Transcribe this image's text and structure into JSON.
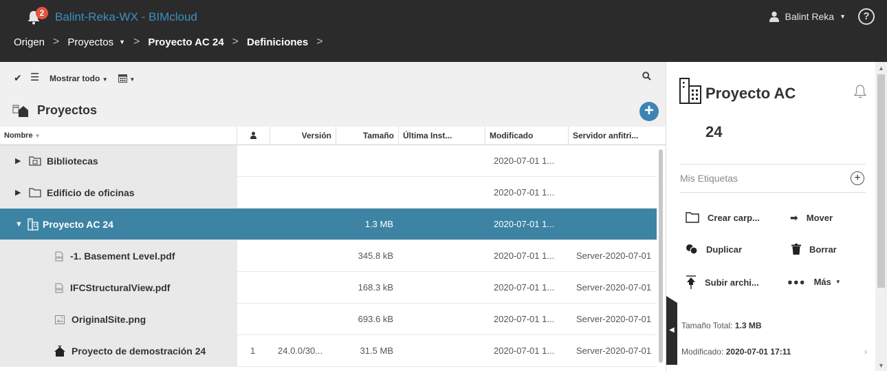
{
  "header": {
    "notification_count": "2",
    "title": "Balint-Reka-WX - BIMcloud",
    "user_name": "Balint Reka",
    "help": "?"
  },
  "breadcrumb": [
    {
      "label": "Origen"
    },
    {
      "label": "Proyectos"
    },
    {
      "label": "Proyecto AC 24"
    },
    {
      "label": "Definiciones"
    }
  ],
  "toolbar": {
    "filter_label": "Mostrar todo"
  },
  "section": {
    "title": "Proyectos"
  },
  "table": {
    "columns": [
      "Nombre",
      "",
      "Versión",
      "Tamaño",
      "Última Inst...",
      "Modificado",
      "Servidor anfitri..."
    ],
    "rows": [
      {
        "name": "Bibliotecas",
        "users": "",
        "version": "",
        "size": "",
        "last": "",
        "modified": "2020-07-01 1...",
        "server": ""
      },
      {
        "name": "Edificio de oficinas",
        "users": "",
        "version": "",
        "size": "",
        "last": "",
        "modified": "2020-07-01 1...",
        "server": ""
      },
      {
        "name": "Proyecto AC 24",
        "users": "",
        "version": "",
        "size": "1.3 MB",
        "last": "",
        "modified": "2020-07-01 1...",
        "server": ""
      },
      {
        "name": "-1. Basement Level.pdf",
        "users": "",
        "version": "",
        "size": "345.8 kB",
        "last": "",
        "modified": "2020-07-01 1...",
        "server": "Server-2020-07-01"
      },
      {
        "name": "IFCStructuralView.pdf",
        "users": "",
        "version": "",
        "size": "168.3 kB",
        "last": "",
        "modified": "2020-07-01 1...",
        "server": "Server-2020-07-01"
      },
      {
        "name": "OriginalSite.png",
        "users": "",
        "version": "",
        "size": "693.6 kB",
        "last": "",
        "modified": "2020-07-01 1...",
        "server": "Server-2020-07-01"
      },
      {
        "name": "Proyecto de demostración 24",
        "users": "1",
        "version": "24.0.0/30...",
        "size": "31.5 MB",
        "last": "",
        "modified": "2020-07-01 1...",
        "server": "Server-2020-07-01"
      }
    ]
  },
  "details": {
    "title": "Proyecto AC 24",
    "tags_label": "Mis Etiquetas",
    "actions": {
      "create_folder": "Crear carp...",
      "move": "Mover",
      "duplicate": "Duplicar",
      "delete": "Borrar",
      "upload": "Subir archi...",
      "more": "Más"
    },
    "size_label": "Tamaño Total:",
    "size_value": "1.3 MB",
    "modified_label": "Modificado:",
    "modified_value": "2020-07-01 17:11"
  },
  "colors": {
    "header_bg": "#2b2b2b",
    "accent": "#3b8fc2",
    "selected_row": "#3d84a4",
    "badge": "#e4543f"
  }
}
